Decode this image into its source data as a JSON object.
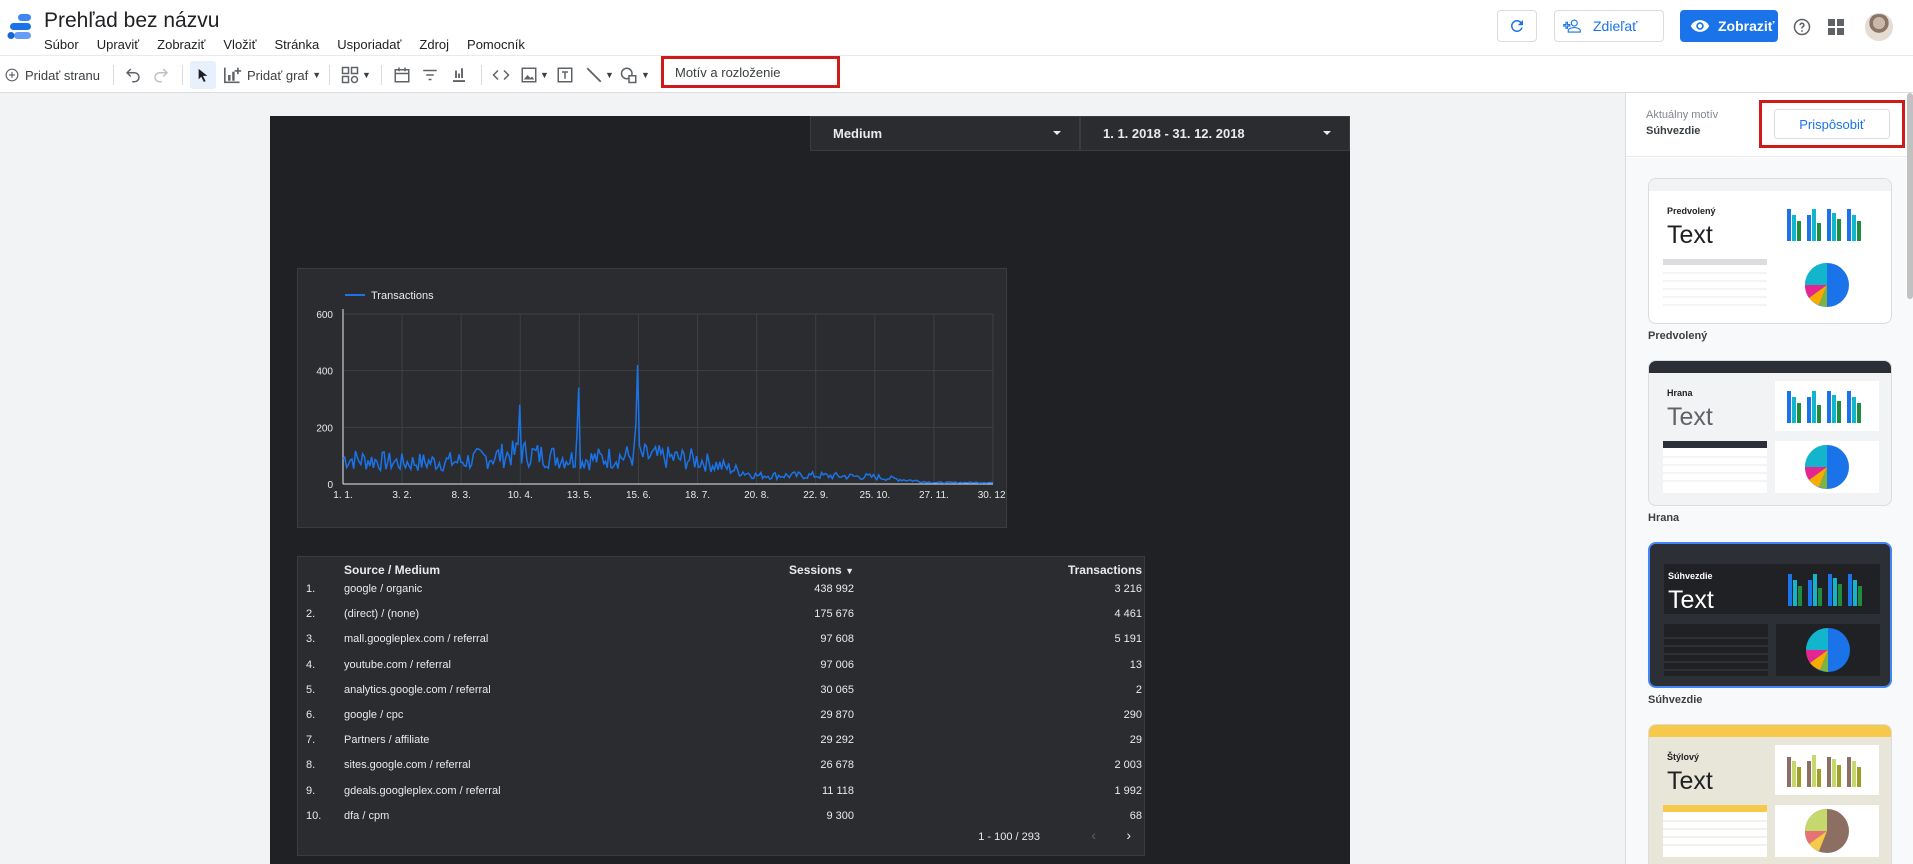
{
  "app": {
    "title": "Prehľad bez názvu",
    "menu": [
      "Súbor",
      "Upraviť",
      "Zobraziť",
      "Vložiť",
      "Stránka",
      "Usporiadať",
      "Zdroj",
      "Pomocník"
    ]
  },
  "header_actions": {
    "share_label": "Zdieľať",
    "view_label": "Zobraziť"
  },
  "toolbar": {
    "add_page": "Pridať stranu",
    "add_chart": "Pridať graf",
    "theme_layout": "Motív a rozloženie"
  },
  "report": {
    "filter_medium": "Medium",
    "date_range": "1. 1. 2018 - 31. 12. 2018",
    "chart": {
      "legend": "Transactions",
      "y_ticks": [
        "600",
        "400",
        "200",
        "0"
      ],
      "x_ticks": [
        "1. 1.",
        "3. 2.",
        "8. 3.",
        "10. 4.",
        "13. 5.",
        "15. 6.",
        "18. 7.",
        "20. 8.",
        "22. 9.",
        "25. 10.",
        "27. 11.",
        "30. 12."
      ]
    },
    "table": {
      "headers": [
        "Source / Medium",
        "Sessions",
        "Transactions"
      ],
      "rows": [
        [
          "1.",
          "google / organic",
          "438 992",
          "3 216"
        ],
        [
          "2.",
          "(direct) / (none)",
          "175 676",
          "4 461"
        ],
        [
          "3.",
          "mall.googleplex.com / referral",
          "97 608",
          "5 191"
        ],
        [
          "4.",
          "youtube.com / referral",
          "97 006",
          "13"
        ],
        [
          "5.",
          "analytics.google.com / referral",
          "30 065",
          "2"
        ],
        [
          "6.",
          "google / cpc",
          "29 870",
          "290"
        ],
        [
          "7.",
          "Partners / affiliate",
          "29 292",
          "29"
        ],
        [
          "8.",
          "sites.google.com / referral",
          "26 678",
          "2 003"
        ],
        [
          "9.",
          "gdeals.googleplex.com / referral",
          "11 118",
          "1 992"
        ],
        [
          "10.",
          "dfa / cpm",
          "9 300",
          "68"
        ]
      ],
      "pagination": "1 - 100 / 293"
    }
  },
  "panel": {
    "current_theme_label": "Aktuálny motív",
    "current_theme_value": "Súhvezdie",
    "customize_label": "Prispôsobiť",
    "themes": [
      {
        "name": "Predvolený",
        "card_title": "Predvolený",
        "text": "Text"
      },
      {
        "name": "Hrana",
        "card_title": "Hrana",
        "text": "Text"
      },
      {
        "name": "Súhvezdie",
        "card_title": "Súhvezdie",
        "text": "Text"
      },
      {
        "name": "Štýlový",
        "card_title": "Štýlový",
        "text": "Text"
      }
    ]
  },
  "chart_data": {
    "type": "line",
    "title": "",
    "xlabel": "",
    "ylabel": "",
    "ylim": [
      0,
      600
    ],
    "x": [
      "1. 1.",
      "3. 2.",
      "8. 3.",
      "10. 4.",
      "13. 5.",
      "15. 6.",
      "18. 7.",
      "20. 8.",
      "22. 9.",
      "25. 10.",
      "27. 11.",
      "30. 12."
    ],
    "series": [
      {
        "name": "Transactions",
        "values": [
          90,
          75,
          80,
          110,
          85,
          100,
          85,
          30,
          30,
          25,
          5,
          5
        ]
      }
    ],
    "peaks": [
      {
        "x": "10. 4.",
        "value": 280
      },
      {
        "x": "13. 5.",
        "value": 340
      },
      {
        "x": "15. 6.",
        "value": 420
      }
    ],
    "colors": {
      "line": "#1a73e8",
      "accent": "#1a73e8",
      "highlight": "#d01b1b"
    }
  }
}
